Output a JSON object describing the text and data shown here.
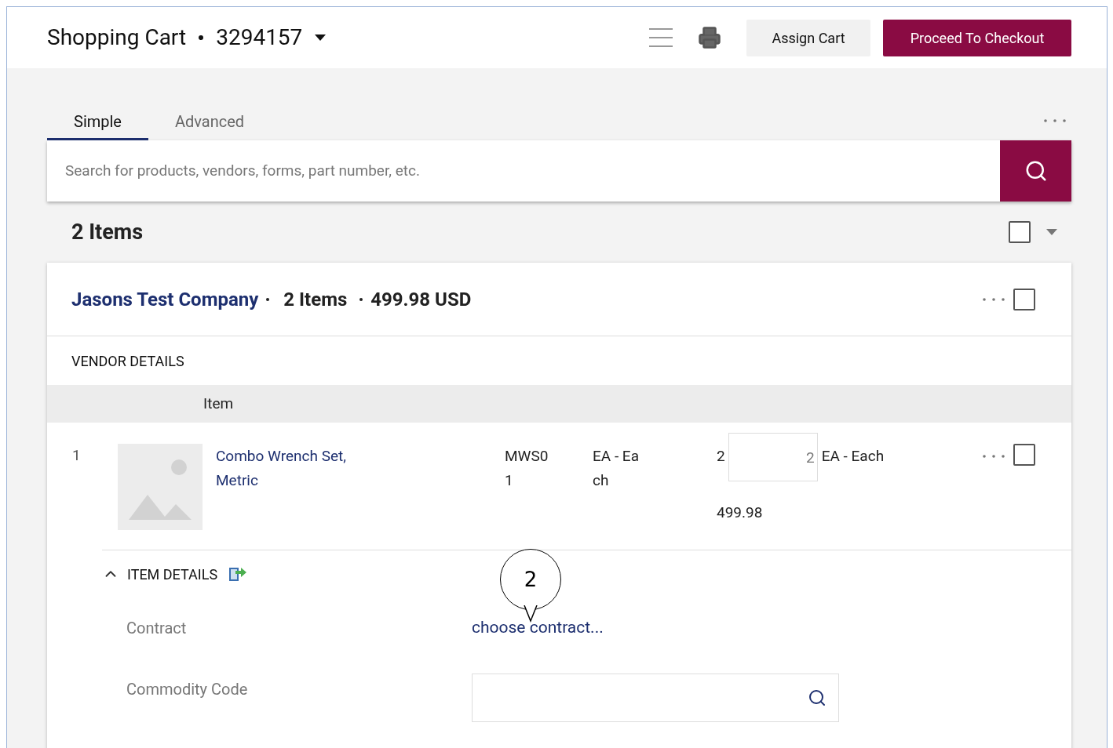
{
  "header": {
    "title": "Shopping Cart",
    "cart_number": "3294157",
    "assign_button": "Assign Cart",
    "checkout_button": "Proceed To Checkout"
  },
  "tabs": [
    {
      "label": "Simple",
      "selected": true
    },
    {
      "label": "Advanced",
      "selected": false
    }
  ],
  "search": {
    "placeholder": "Search for products, vendors, forms, part number, etc."
  },
  "items_heading": {
    "title": "2 Items",
    "checked": false
  },
  "vendor": {
    "name": "Jasons Test Company",
    "count": "2 Items",
    "total": "499.98 USD",
    "checked": false,
    "section_label": "VENDOR DETAILS"
  },
  "table": {
    "columns": [
      "Item"
    ],
    "rows": [
      {
        "number": "1",
        "name": "Combo Wrench Set, Metric",
        "part_number": "MWS0 1",
        "unit": "EA - Ea ch",
        "price_prefix": "2",
        "quantity": "2",
        "quantity_unit": "EA - Each",
        "amount": "499.98",
        "checked": false
      }
    ]
  },
  "item_details": {
    "title": "ITEM DETAILS",
    "expanded": true,
    "fields": [
      {
        "kind": "link",
        "label": "Contract",
        "value": "choose contract..."
      },
      {
        "kind": "search",
        "label": "Commodity Code"
      }
    ]
  },
  "callout": {
    "text": "2"
  }
}
